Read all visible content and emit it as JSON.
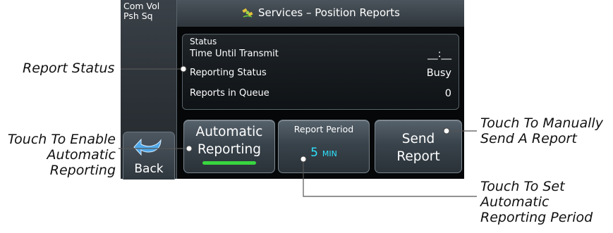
{
  "sidebar": {
    "com_vol_line1": "Com Vol",
    "com_vol_line2": "Psh Sq"
  },
  "header": {
    "title": "Services – Position Reports",
    "icon": "satellite-icon"
  },
  "status": {
    "legend": "Status",
    "rows": [
      {
        "label": "Time Until Transmit",
        "value": "__:__"
      },
      {
        "label": "Reporting Status",
        "value": "Busy"
      },
      {
        "label": "Reports in Queue",
        "value": "0"
      }
    ]
  },
  "buttons": {
    "automatic": {
      "line1": "Automatic",
      "line2": "Reporting",
      "annunciator_color": "#39d63f"
    },
    "period": {
      "label": "Report Period",
      "value": "5",
      "unit": "MIN",
      "value_color": "#2ee3ff"
    },
    "send": {
      "line1": "Send",
      "line2": "Report"
    },
    "back": {
      "label": "Back",
      "icon": "back-arrow-icon"
    }
  },
  "callouts": {
    "report_status": "Report Status",
    "enable_auto": [
      "Touch To Enable",
      "Automatic",
      "Reporting"
    ],
    "manual_send": [
      "Touch To Manually",
      "Send A Report"
    ],
    "set_period": [
      "Touch To Set",
      "Automatic",
      "Reporting Period"
    ]
  }
}
